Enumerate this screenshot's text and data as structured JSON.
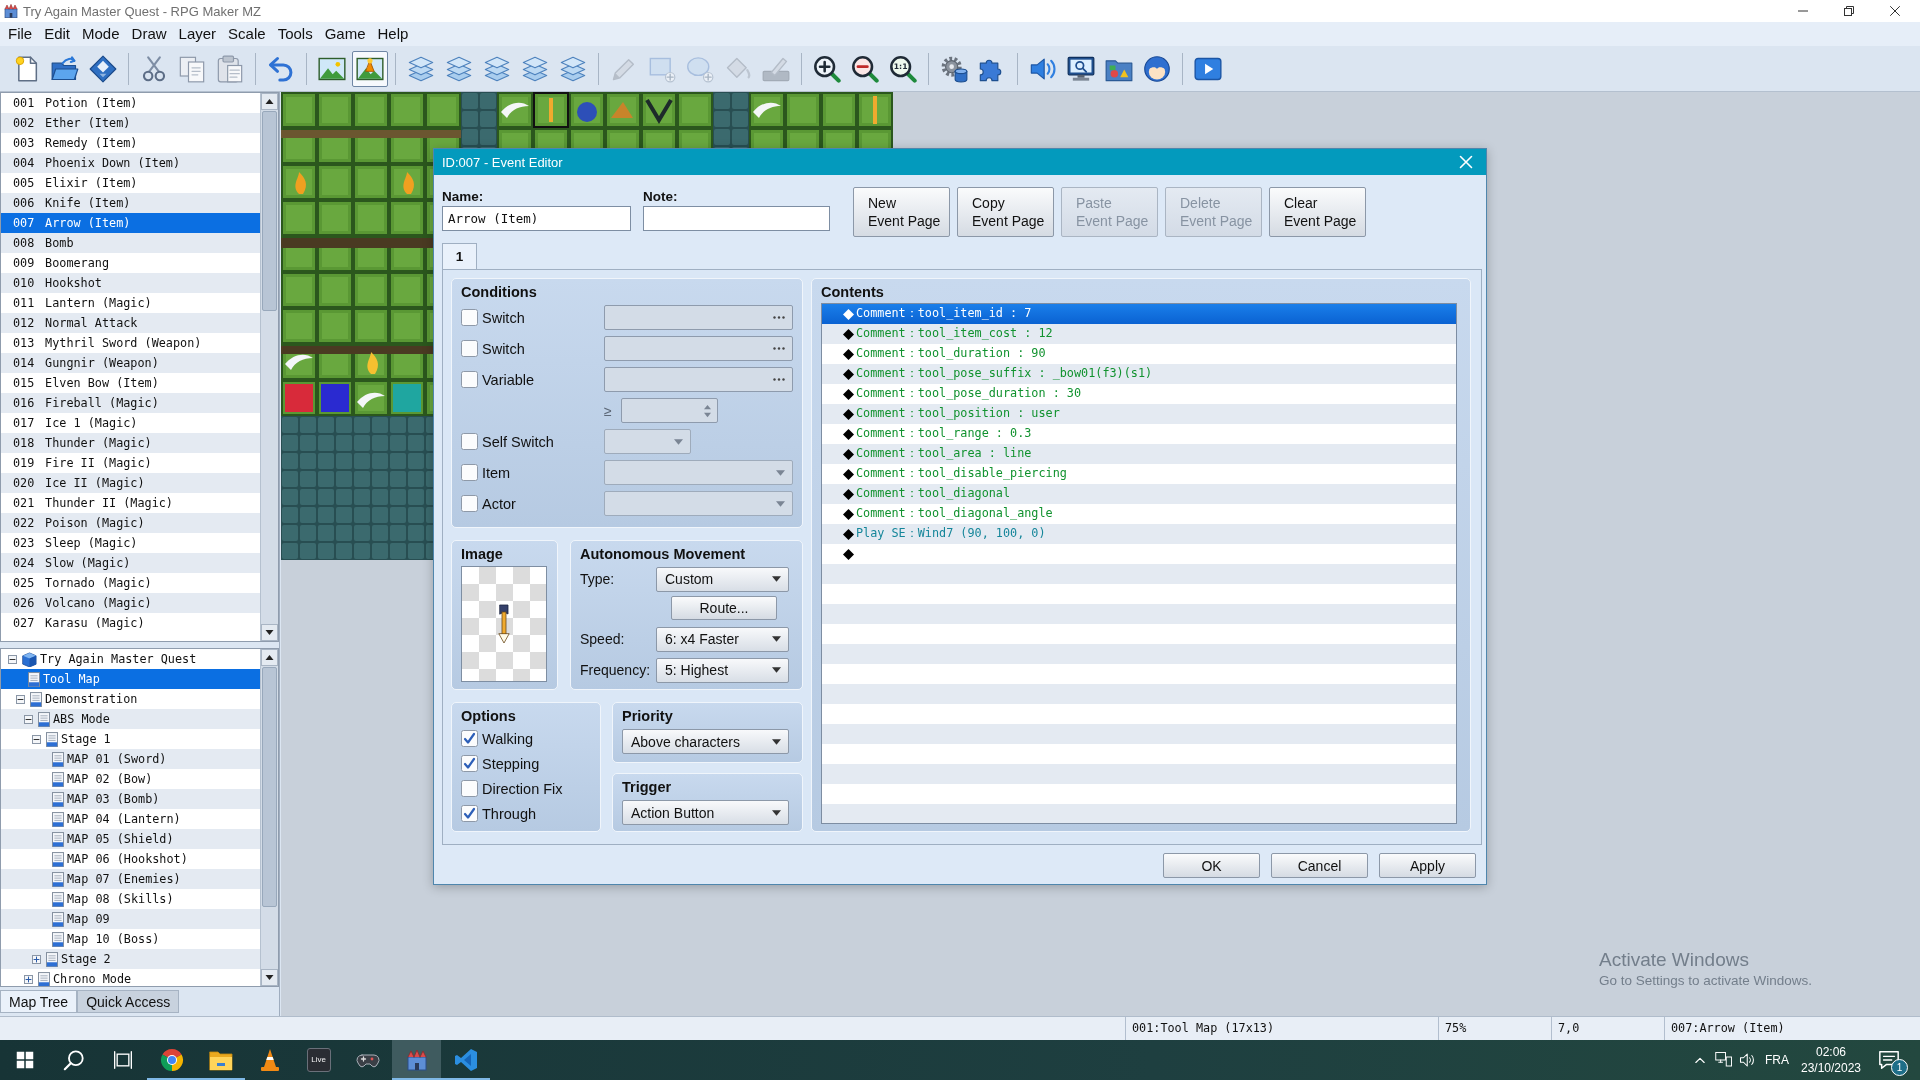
{
  "window": {
    "title": "Try Again Master Quest - RPG Maker MZ"
  },
  "menu": [
    "File",
    "Edit",
    "Mode",
    "Draw",
    "Layer",
    "Scale",
    "Tools",
    "Game",
    "Help"
  ],
  "toolbar": {
    "modes": [
      {
        "selected": false
      },
      {
        "selected": true
      }
    ],
    "drawing_tools": [
      {
        "disabled": true
      },
      {
        "disabled": true
      },
      {
        "disabled": true
      },
      {
        "disabled": true
      },
      {
        "disabled": true
      }
    ],
    "zoom_reset_label": "1:1"
  },
  "event_list": [
    {
      "number": "001",
      "name": "Potion (Item)",
      "selected": false
    },
    {
      "number": "002",
      "name": "Ether (Item)",
      "selected": false
    },
    {
      "number": "003",
      "name": "Remedy (Item)",
      "selected": false
    },
    {
      "number": "004",
      "name": "Phoenix Down (Item)",
      "selected": false
    },
    {
      "number": "005",
      "name": "Elixir (Item)",
      "selected": false
    },
    {
      "number": "006",
      "name": "Knife (Item)",
      "selected": false
    },
    {
      "number": "007",
      "name": "Arrow (Item)",
      "selected": true
    },
    {
      "number": "008",
      "name": "Bomb",
      "selected": false
    },
    {
      "number": "009",
      "name": "Boomerang",
      "selected": false
    },
    {
      "number": "010",
      "name": "Hookshot",
      "selected": false
    },
    {
      "number": "011",
      "name": "Lantern (Magic)",
      "selected": false
    },
    {
      "number": "012",
      "name": "Normal Attack",
      "selected": false
    },
    {
      "number": "013",
      "name": "Mythril Sword (Weapon)",
      "selected": false
    },
    {
      "number": "014",
      "name": "Gungnir (Weapon)",
      "selected": false
    },
    {
      "number": "015",
      "name": "Elven Bow (Item)",
      "selected": false
    },
    {
      "number": "016",
      "name": "Fireball (Magic)",
      "selected": false
    },
    {
      "number": "017",
      "name": "Ice 1 (Magic)",
      "selected": false
    },
    {
      "number": "018",
      "name": "Thunder (Magic)",
      "selected": false
    },
    {
      "number": "019",
      "name": "Fire II (Magic)",
      "selected": false
    },
    {
      "number": "020",
      "name": "Ice II (Magic)",
      "selected": false
    },
    {
      "number": "021",
      "name": "Thunder II (Magic)",
      "selected": false
    },
    {
      "number": "022",
      "name": "Poison (Magic)",
      "selected": false
    },
    {
      "number": "023",
      "name": "Sleep (Magic)",
      "selected": false
    },
    {
      "number": "024",
      "name": "Slow (Magic)",
      "selected": false
    },
    {
      "number": "025",
      "name": "Tornado (Magic)",
      "selected": false
    },
    {
      "number": "026",
      "name": "Volcano (Magic)",
      "selected": false
    },
    {
      "number": "027",
      "name": "Karasu (Magic)",
      "selected": false
    }
  ],
  "map_tree": [
    {
      "label": "Try Again Master Quest",
      "kind": "project",
      "expanded": true,
      "selected": false,
      "children": [
        {
          "label": "Tool Map",
          "kind": "map",
          "selected": true
        },
        {
          "label": "Demonstration",
          "kind": "map",
          "expanded": true,
          "selected": false,
          "children": [
            {
              "label": "ABS Mode",
              "kind": "map",
              "expanded": true,
              "selected": false,
              "children": [
                {
                  "label": "Stage 1",
                  "kind": "map",
                  "expanded": true,
                  "selected": false,
                  "children": [
                    {
                      "label": "MAP 01 (Sword)",
                      "kind": "map",
                      "selected": false
                    },
                    {
                      "label": "MAP 02 (Bow)",
                      "kind": "map",
                      "selected": false
                    },
                    {
                      "label": "MAP 03 (Bomb)",
                      "kind": "map",
                      "selected": false
                    },
                    {
                      "label": "MAP 04 (Lantern)",
                      "kind": "map",
                      "selected": false
                    },
                    {
                      "label": "MAP 05 (Shield)",
                      "kind": "map",
                      "selected": false
                    },
                    {
                      "label": "MAP 06 (Hookshot)",
                      "kind": "map",
                      "selected": false
                    },
                    {
                      "label": "Map 07 (Enemies)",
                      "kind": "map",
                      "selected": false
                    },
                    {
                      "label": "Map 08 (Skills)",
                      "kind": "map",
                      "selected": false
                    },
                    {
                      "label": "Map 09",
                      "kind": "map",
                      "selected": false
                    },
                    {
                      "label": "Map 10 (Boss)",
                      "kind": "map",
                      "selected": false
                    }
                  ]
                },
                {
                  "label": "Stage 2",
                  "kind": "map",
                  "expanded": false,
                  "selected": false
                }
              ]
            },
            {
              "label": "Chrono Mode",
              "kind": "map",
              "expanded": false,
              "selected": false
            }
          ]
        }
      ]
    }
  ],
  "left_tabs": [
    {
      "label": "Map Tree",
      "selected": true
    },
    {
      "label": "Quick Access",
      "selected": false
    }
  ],
  "event_editor": {
    "title": "ID:007 - Event Editor",
    "name": {
      "label": "Name:",
      "value": "Arrow (Item)"
    },
    "note": {
      "label": "Note:"
    },
    "page_buttons": [
      {
        "lines": [
          "New",
          "Event Page"
        ],
        "disabled": false
      },
      {
        "lines": [
          "Copy",
          "Event Page"
        ],
        "disabled": false
      },
      {
        "lines": [
          "Paste",
          "Event Page"
        ],
        "disabled": true
      },
      {
        "lines": [
          "Delete",
          "Event Page"
        ],
        "disabled": true
      },
      {
        "lines": [
          "Clear",
          "Event Page"
        ],
        "disabled": false
      }
    ],
    "page_tabs": [
      {
        "label": "1",
        "selected": true
      }
    ],
    "conditions": {
      "title": "Conditions",
      "rows": [
        {
          "kind": "picker",
          "label": "Switch",
          "checked": false,
          "disabled": true
        },
        {
          "kind": "picker",
          "label": "Switch",
          "checked": false,
          "disabled": true
        },
        {
          "kind": "picker",
          "label": "Variable",
          "checked": false,
          "disabled": true
        },
        {
          "kind": "compare",
          "symbol": "≥",
          "disabled": true
        },
        {
          "kind": "short_combo",
          "label": "Self Switch",
          "checked": false,
          "disabled": true
        },
        {
          "kind": "combo",
          "label": "Item",
          "checked": false,
          "disabled": true
        },
        {
          "kind": "combo",
          "label": "Actor",
          "checked": false,
          "disabled": true
        }
      ]
    },
    "image": {
      "title": "Image"
    },
    "movement": {
      "title": "Autonomous Movement",
      "type": {
        "label": "Type:",
        "value": "Custom"
      },
      "route_button": "Route...",
      "speed": {
        "label": "Speed:",
        "value": "6: x4 Faster"
      },
      "frequency": {
        "label": "Frequency:",
        "value": "5: Highest"
      }
    },
    "options": {
      "title": "Options",
      "items": [
        {
          "label": "Walking",
          "checked": true
        },
        {
          "label": "Stepping",
          "checked": true
        },
        {
          "label": "Direction Fix",
          "checked": false
        },
        {
          "label": "Through",
          "checked": true
        }
      ]
    },
    "priority": {
      "title": "Priority",
      "value": "Above characters"
    },
    "trigger": {
      "title": "Trigger",
      "value": "Action Button"
    },
    "contents": {
      "title": "Contents",
      "commands": [
        {
          "kind": "comment",
          "text": "Comment：tool_item_id : 7",
          "selected": true
        },
        {
          "kind": "comment",
          "text": "Comment：tool_item_cost : 12",
          "selected": false
        },
        {
          "kind": "comment",
          "text": "Comment：tool_duration : 90",
          "selected": false
        },
        {
          "kind": "comment",
          "text": "Comment：tool_pose_suffix : _bow01(f3)(s1)",
          "selected": false
        },
        {
          "kind": "comment",
          "text": "Comment：tool_pose_duration : 30",
          "selected": false
        },
        {
          "kind": "comment",
          "text": "Comment：tool_position : user",
          "selected": false
        },
        {
          "kind": "comment",
          "text": "Comment：tool_range : 0.3",
          "selected": false
        },
        {
          "kind": "comment",
          "text": "Comment：tool_area : line",
          "selected": false
        },
        {
          "kind": "comment",
          "text": "Comment：tool_disable_piercing",
          "selected": false
        },
        {
          "kind": "comment",
          "text": "Comment：tool_diagonal",
          "selected": false
        },
        {
          "kind": "comment",
          "text": "Comment：tool_diagonal_angle",
          "selected": false
        },
        {
          "kind": "play_se",
          "text": "Play SE：Wind7 (90, 100, 0)",
          "selected": false
        },
        {
          "kind": "end",
          "selected": false
        }
      ]
    },
    "buttons": [
      "OK",
      "Cancel",
      "Apply"
    ]
  },
  "activation_notice": {
    "title": "Activate Windows",
    "hint": "Go to Settings to activate Windows."
  },
  "status_bar": [
    "001:Tool Map (17x13)",
    "75%",
    "7,0",
    "007:Arrow (Item)"
  ],
  "taskbar": {
    "apps": [
      {
        "kind": "browser",
        "running": true,
        "active": false
      },
      {
        "kind": "folder",
        "running": true,
        "active": false
      },
      {
        "kind": "cone",
        "running": false,
        "active": false
      },
      {
        "kind": "live",
        "label": "Live",
        "running": false,
        "active": false
      },
      {
        "kind": "gamepad",
        "running": false,
        "active": false
      },
      {
        "kind": "rpg_maker",
        "running": true,
        "active": true
      },
      {
        "kind": "code_editor",
        "running": true,
        "active": false
      }
    ],
    "tray": {
      "language": "FRA",
      "time": "02:06",
      "date": "23/10/2023",
      "notifications": "1"
    }
  }
}
